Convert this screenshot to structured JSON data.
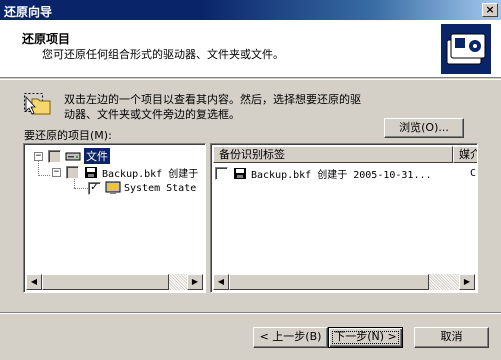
{
  "window": {
    "title": "还原向导",
    "close_glyph": "×"
  },
  "header": {
    "title": "还原项目",
    "subtitle": "您可还原任何组合形式的驱动器、文件夹或文件。",
    "logo_icon": "backup-cards-icon"
  },
  "info": {
    "icon": "folder-select-icon",
    "line1": "双击左边的一个项目以查看其内容。然后，选择想要还原的驱",
    "line2": "动器、文件夹或文件旁边的复选框。"
  },
  "browse_button": {
    "label": "浏览(O)..."
  },
  "items_label": "要还原的项目(M):",
  "tree": {
    "items": [
      {
        "label": "文件",
        "expander": "−",
        "icon": "disk-drive-icon",
        "selected": true,
        "checked": false
      },
      {
        "label": "Backup.bkf 创建于",
        "expander": "−",
        "icon": "backup-file-icon",
        "checked": false
      },
      {
        "label": "System State",
        "icon": "system-state-icon",
        "checked": true
      }
    ]
  },
  "list": {
    "columns": [
      "备份识别标签",
      "媒介"
    ],
    "rows": [
      {
        "label": "Backup.bkf 创建于 2005-10-31...",
        "media": "C:\\",
        "checked": false
      }
    ]
  },
  "buttons": {
    "back": "< 上一步(B)",
    "next": "下一步(N) >",
    "cancel": "取消"
  },
  "colors": {
    "title_bar_start": "#0a246a",
    "title_bar_end": "#a6caf0",
    "dialog_bg": "#d4d0c8",
    "selection": "#0a246a"
  }
}
